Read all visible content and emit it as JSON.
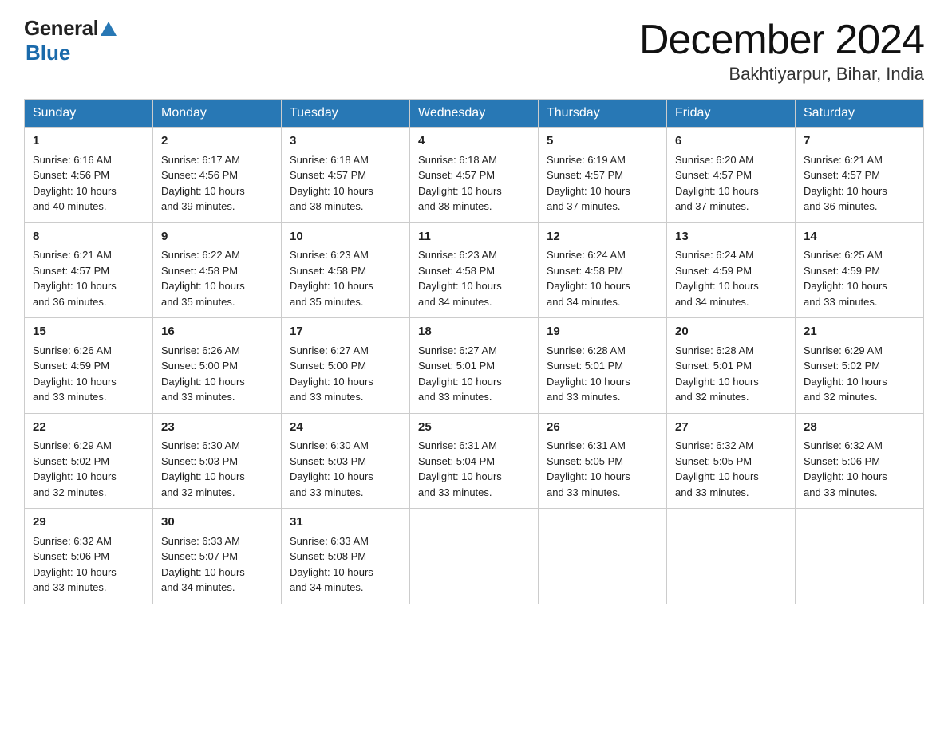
{
  "header": {
    "logo_general": "General",
    "logo_blue": "Blue",
    "month_year": "December 2024",
    "location": "Bakhtiyarpur, Bihar, India"
  },
  "days_of_week": [
    "Sunday",
    "Monday",
    "Tuesday",
    "Wednesday",
    "Thursday",
    "Friday",
    "Saturday"
  ],
  "weeks": [
    [
      {
        "day": "1",
        "sunrise": "6:16 AM",
        "sunset": "4:56 PM",
        "daylight": "10 hours and 40 minutes."
      },
      {
        "day": "2",
        "sunrise": "6:17 AM",
        "sunset": "4:56 PM",
        "daylight": "10 hours and 39 minutes."
      },
      {
        "day": "3",
        "sunrise": "6:18 AM",
        "sunset": "4:57 PM",
        "daylight": "10 hours and 38 minutes."
      },
      {
        "day": "4",
        "sunrise": "6:18 AM",
        "sunset": "4:57 PM",
        "daylight": "10 hours and 38 minutes."
      },
      {
        "day": "5",
        "sunrise": "6:19 AM",
        "sunset": "4:57 PM",
        "daylight": "10 hours and 37 minutes."
      },
      {
        "day": "6",
        "sunrise": "6:20 AM",
        "sunset": "4:57 PM",
        "daylight": "10 hours and 37 minutes."
      },
      {
        "day": "7",
        "sunrise": "6:21 AM",
        "sunset": "4:57 PM",
        "daylight": "10 hours and 36 minutes."
      }
    ],
    [
      {
        "day": "8",
        "sunrise": "6:21 AM",
        "sunset": "4:57 PM",
        "daylight": "10 hours and 36 minutes."
      },
      {
        "day": "9",
        "sunrise": "6:22 AM",
        "sunset": "4:58 PM",
        "daylight": "10 hours and 35 minutes."
      },
      {
        "day": "10",
        "sunrise": "6:23 AM",
        "sunset": "4:58 PM",
        "daylight": "10 hours and 35 minutes."
      },
      {
        "day": "11",
        "sunrise": "6:23 AM",
        "sunset": "4:58 PM",
        "daylight": "10 hours and 34 minutes."
      },
      {
        "day": "12",
        "sunrise": "6:24 AM",
        "sunset": "4:58 PM",
        "daylight": "10 hours and 34 minutes."
      },
      {
        "day": "13",
        "sunrise": "6:24 AM",
        "sunset": "4:59 PM",
        "daylight": "10 hours and 34 minutes."
      },
      {
        "day": "14",
        "sunrise": "6:25 AM",
        "sunset": "4:59 PM",
        "daylight": "10 hours and 33 minutes."
      }
    ],
    [
      {
        "day": "15",
        "sunrise": "6:26 AM",
        "sunset": "4:59 PM",
        "daylight": "10 hours and 33 minutes."
      },
      {
        "day": "16",
        "sunrise": "6:26 AM",
        "sunset": "5:00 PM",
        "daylight": "10 hours and 33 minutes."
      },
      {
        "day": "17",
        "sunrise": "6:27 AM",
        "sunset": "5:00 PM",
        "daylight": "10 hours and 33 minutes."
      },
      {
        "day": "18",
        "sunrise": "6:27 AM",
        "sunset": "5:01 PM",
        "daylight": "10 hours and 33 minutes."
      },
      {
        "day": "19",
        "sunrise": "6:28 AM",
        "sunset": "5:01 PM",
        "daylight": "10 hours and 33 minutes."
      },
      {
        "day": "20",
        "sunrise": "6:28 AM",
        "sunset": "5:01 PM",
        "daylight": "10 hours and 32 minutes."
      },
      {
        "day": "21",
        "sunrise": "6:29 AM",
        "sunset": "5:02 PM",
        "daylight": "10 hours and 32 minutes."
      }
    ],
    [
      {
        "day": "22",
        "sunrise": "6:29 AM",
        "sunset": "5:02 PM",
        "daylight": "10 hours and 32 minutes."
      },
      {
        "day": "23",
        "sunrise": "6:30 AM",
        "sunset": "5:03 PM",
        "daylight": "10 hours and 32 minutes."
      },
      {
        "day": "24",
        "sunrise": "6:30 AM",
        "sunset": "5:03 PM",
        "daylight": "10 hours and 33 minutes."
      },
      {
        "day": "25",
        "sunrise": "6:31 AM",
        "sunset": "5:04 PM",
        "daylight": "10 hours and 33 minutes."
      },
      {
        "day": "26",
        "sunrise": "6:31 AM",
        "sunset": "5:05 PM",
        "daylight": "10 hours and 33 minutes."
      },
      {
        "day": "27",
        "sunrise": "6:32 AM",
        "sunset": "5:05 PM",
        "daylight": "10 hours and 33 minutes."
      },
      {
        "day": "28",
        "sunrise": "6:32 AM",
        "sunset": "5:06 PM",
        "daylight": "10 hours and 33 minutes."
      }
    ],
    [
      {
        "day": "29",
        "sunrise": "6:32 AM",
        "sunset": "5:06 PM",
        "daylight": "10 hours and 33 minutes."
      },
      {
        "day": "30",
        "sunrise": "6:33 AM",
        "sunset": "5:07 PM",
        "daylight": "10 hours and 34 minutes."
      },
      {
        "day": "31",
        "sunrise": "6:33 AM",
        "sunset": "5:08 PM",
        "daylight": "10 hours and 34 minutes."
      },
      null,
      null,
      null,
      null
    ]
  ],
  "labels": {
    "sunrise": "Sunrise:",
    "sunset": "Sunset:",
    "daylight": "Daylight:"
  }
}
